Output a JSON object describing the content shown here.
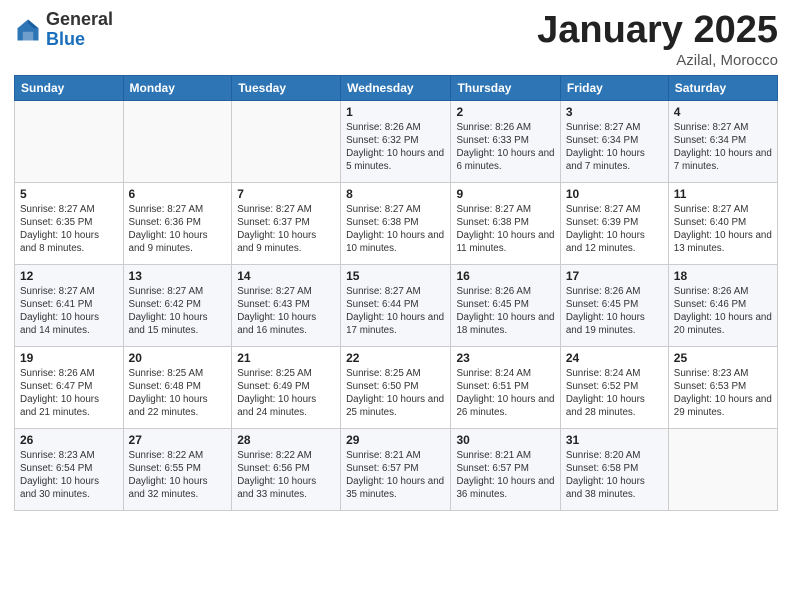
{
  "header": {
    "logo_general": "General",
    "logo_blue": "Blue",
    "month_title": "January 2025",
    "subtitle": "Azilal, Morocco"
  },
  "weekdays": [
    "Sunday",
    "Monday",
    "Tuesday",
    "Wednesday",
    "Thursday",
    "Friday",
    "Saturday"
  ],
  "weeks": [
    [
      {
        "day": "",
        "sunrise": "",
        "sunset": "",
        "daylight": ""
      },
      {
        "day": "",
        "sunrise": "",
        "sunset": "",
        "daylight": ""
      },
      {
        "day": "",
        "sunrise": "",
        "sunset": "",
        "daylight": ""
      },
      {
        "day": "1",
        "sunrise": "Sunrise: 8:26 AM",
        "sunset": "Sunset: 6:32 PM",
        "daylight": "Daylight: 10 hours and 5 minutes."
      },
      {
        "day": "2",
        "sunrise": "Sunrise: 8:26 AM",
        "sunset": "Sunset: 6:33 PM",
        "daylight": "Daylight: 10 hours and 6 minutes."
      },
      {
        "day": "3",
        "sunrise": "Sunrise: 8:27 AM",
        "sunset": "Sunset: 6:34 PM",
        "daylight": "Daylight: 10 hours and 7 minutes."
      },
      {
        "day": "4",
        "sunrise": "Sunrise: 8:27 AM",
        "sunset": "Sunset: 6:34 PM",
        "daylight": "Daylight: 10 hours and 7 minutes."
      }
    ],
    [
      {
        "day": "5",
        "sunrise": "Sunrise: 8:27 AM",
        "sunset": "Sunset: 6:35 PM",
        "daylight": "Daylight: 10 hours and 8 minutes."
      },
      {
        "day": "6",
        "sunrise": "Sunrise: 8:27 AM",
        "sunset": "Sunset: 6:36 PM",
        "daylight": "Daylight: 10 hours and 9 minutes."
      },
      {
        "day": "7",
        "sunrise": "Sunrise: 8:27 AM",
        "sunset": "Sunset: 6:37 PM",
        "daylight": "Daylight: 10 hours and 9 minutes."
      },
      {
        "day": "8",
        "sunrise": "Sunrise: 8:27 AM",
        "sunset": "Sunset: 6:38 PM",
        "daylight": "Daylight: 10 hours and 10 minutes."
      },
      {
        "day": "9",
        "sunrise": "Sunrise: 8:27 AM",
        "sunset": "Sunset: 6:38 PM",
        "daylight": "Daylight: 10 hours and 11 minutes."
      },
      {
        "day": "10",
        "sunrise": "Sunrise: 8:27 AM",
        "sunset": "Sunset: 6:39 PM",
        "daylight": "Daylight: 10 hours and 12 minutes."
      },
      {
        "day": "11",
        "sunrise": "Sunrise: 8:27 AM",
        "sunset": "Sunset: 6:40 PM",
        "daylight": "Daylight: 10 hours and 13 minutes."
      }
    ],
    [
      {
        "day": "12",
        "sunrise": "Sunrise: 8:27 AM",
        "sunset": "Sunset: 6:41 PM",
        "daylight": "Daylight: 10 hours and 14 minutes."
      },
      {
        "day": "13",
        "sunrise": "Sunrise: 8:27 AM",
        "sunset": "Sunset: 6:42 PM",
        "daylight": "Daylight: 10 hours and 15 minutes."
      },
      {
        "day": "14",
        "sunrise": "Sunrise: 8:27 AM",
        "sunset": "Sunset: 6:43 PM",
        "daylight": "Daylight: 10 hours and 16 minutes."
      },
      {
        "day": "15",
        "sunrise": "Sunrise: 8:27 AM",
        "sunset": "Sunset: 6:44 PM",
        "daylight": "Daylight: 10 hours and 17 minutes."
      },
      {
        "day": "16",
        "sunrise": "Sunrise: 8:26 AM",
        "sunset": "Sunset: 6:45 PM",
        "daylight": "Daylight: 10 hours and 18 minutes."
      },
      {
        "day": "17",
        "sunrise": "Sunrise: 8:26 AM",
        "sunset": "Sunset: 6:45 PM",
        "daylight": "Daylight: 10 hours and 19 minutes."
      },
      {
        "day": "18",
        "sunrise": "Sunrise: 8:26 AM",
        "sunset": "Sunset: 6:46 PM",
        "daylight": "Daylight: 10 hours and 20 minutes."
      }
    ],
    [
      {
        "day": "19",
        "sunrise": "Sunrise: 8:26 AM",
        "sunset": "Sunset: 6:47 PM",
        "daylight": "Daylight: 10 hours and 21 minutes."
      },
      {
        "day": "20",
        "sunrise": "Sunrise: 8:25 AM",
        "sunset": "Sunset: 6:48 PM",
        "daylight": "Daylight: 10 hours and 22 minutes."
      },
      {
        "day": "21",
        "sunrise": "Sunrise: 8:25 AM",
        "sunset": "Sunset: 6:49 PM",
        "daylight": "Daylight: 10 hours and 24 minutes."
      },
      {
        "day": "22",
        "sunrise": "Sunrise: 8:25 AM",
        "sunset": "Sunset: 6:50 PM",
        "daylight": "Daylight: 10 hours and 25 minutes."
      },
      {
        "day": "23",
        "sunrise": "Sunrise: 8:24 AM",
        "sunset": "Sunset: 6:51 PM",
        "daylight": "Daylight: 10 hours and 26 minutes."
      },
      {
        "day": "24",
        "sunrise": "Sunrise: 8:24 AM",
        "sunset": "Sunset: 6:52 PM",
        "daylight": "Daylight: 10 hours and 28 minutes."
      },
      {
        "day": "25",
        "sunrise": "Sunrise: 8:23 AM",
        "sunset": "Sunset: 6:53 PM",
        "daylight": "Daylight: 10 hours and 29 minutes."
      }
    ],
    [
      {
        "day": "26",
        "sunrise": "Sunrise: 8:23 AM",
        "sunset": "Sunset: 6:54 PM",
        "daylight": "Daylight: 10 hours and 30 minutes."
      },
      {
        "day": "27",
        "sunrise": "Sunrise: 8:22 AM",
        "sunset": "Sunset: 6:55 PM",
        "daylight": "Daylight: 10 hours and 32 minutes."
      },
      {
        "day": "28",
        "sunrise": "Sunrise: 8:22 AM",
        "sunset": "Sunset: 6:56 PM",
        "daylight": "Daylight: 10 hours and 33 minutes."
      },
      {
        "day": "29",
        "sunrise": "Sunrise: 8:21 AM",
        "sunset": "Sunset: 6:57 PM",
        "daylight": "Daylight: 10 hours and 35 minutes."
      },
      {
        "day": "30",
        "sunrise": "Sunrise: 8:21 AM",
        "sunset": "Sunset: 6:57 PM",
        "daylight": "Daylight: 10 hours and 36 minutes."
      },
      {
        "day": "31",
        "sunrise": "Sunrise: 8:20 AM",
        "sunset": "Sunset: 6:58 PM",
        "daylight": "Daylight: 10 hours and 38 minutes."
      },
      {
        "day": "",
        "sunrise": "",
        "sunset": "",
        "daylight": ""
      }
    ]
  ]
}
